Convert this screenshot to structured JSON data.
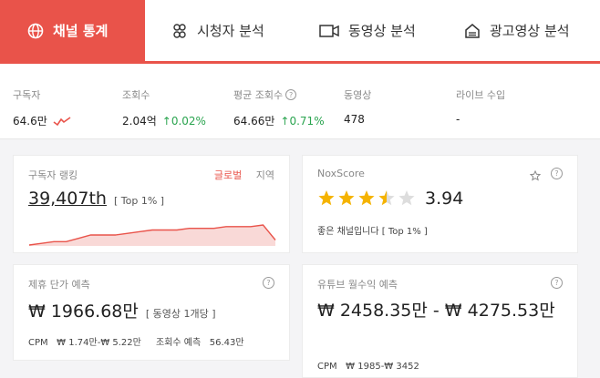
{
  "tabs": [
    {
      "label": "채널 통계",
      "icon": "globe-icon"
    },
    {
      "label": "시청자 분석",
      "icon": "audience-icon"
    },
    {
      "label": "동영상 분석",
      "icon": "video-camera-icon"
    },
    {
      "label": "광고영상 분석",
      "icon": "ad-house-icon"
    }
  ],
  "stats": {
    "subscribers": {
      "label": "구독자",
      "value": "64.6만"
    },
    "views": {
      "label": "조회수",
      "value": "2.04억",
      "change": "0.02%"
    },
    "avg_views": {
      "label": "평균 조회수",
      "value": "64.66만",
      "change": "0.71%"
    },
    "videos": {
      "label": "동영상",
      "value": "478"
    },
    "live_income": {
      "label": "라이브 수입",
      "value": "-"
    }
  },
  "ranking": {
    "title": "구독자 랭킹",
    "tab_global": "글로벌",
    "tab_region": "지역",
    "rank": "39,407th",
    "top": "[ Top 1% ]"
  },
  "chart_data": {
    "type": "area",
    "values": [
      0,
      1,
      2,
      2,
      4,
      6,
      6,
      6,
      7,
      8,
      9,
      9,
      9,
      10,
      10,
      10,
      11,
      11,
      11,
      12,
      3
    ],
    "color": "#e9534a"
  },
  "noxscore": {
    "title": "NoxScore",
    "rating": 3.5,
    "max_stars": 5,
    "score": "3.94",
    "desc": "좋은 채널입니다 [ Top 1% ]"
  },
  "pricing": {
    "title": "제휴 단가 예측",
    "value": "₩ 1966.68만",
    "unit": "[ 동영상 1개당 ]",
    "cpm": "CPM   ₩ 1.74만-₩ 5.22만",
    "views_est": "조회수 예측   56.43만"
  },
  "revenue": {
    "title": "유튜브 월수익 예측",
    "value": "₩ 2458.35만 - ₩ 4275.53만",
    "cpm": "CPM   ₩ 1985-₩ 3452"
  },
  "colors": {
    "accent": "#e9534a",
    "up": "#2aa44f",
    "star": "#f5b301"
  }
}
